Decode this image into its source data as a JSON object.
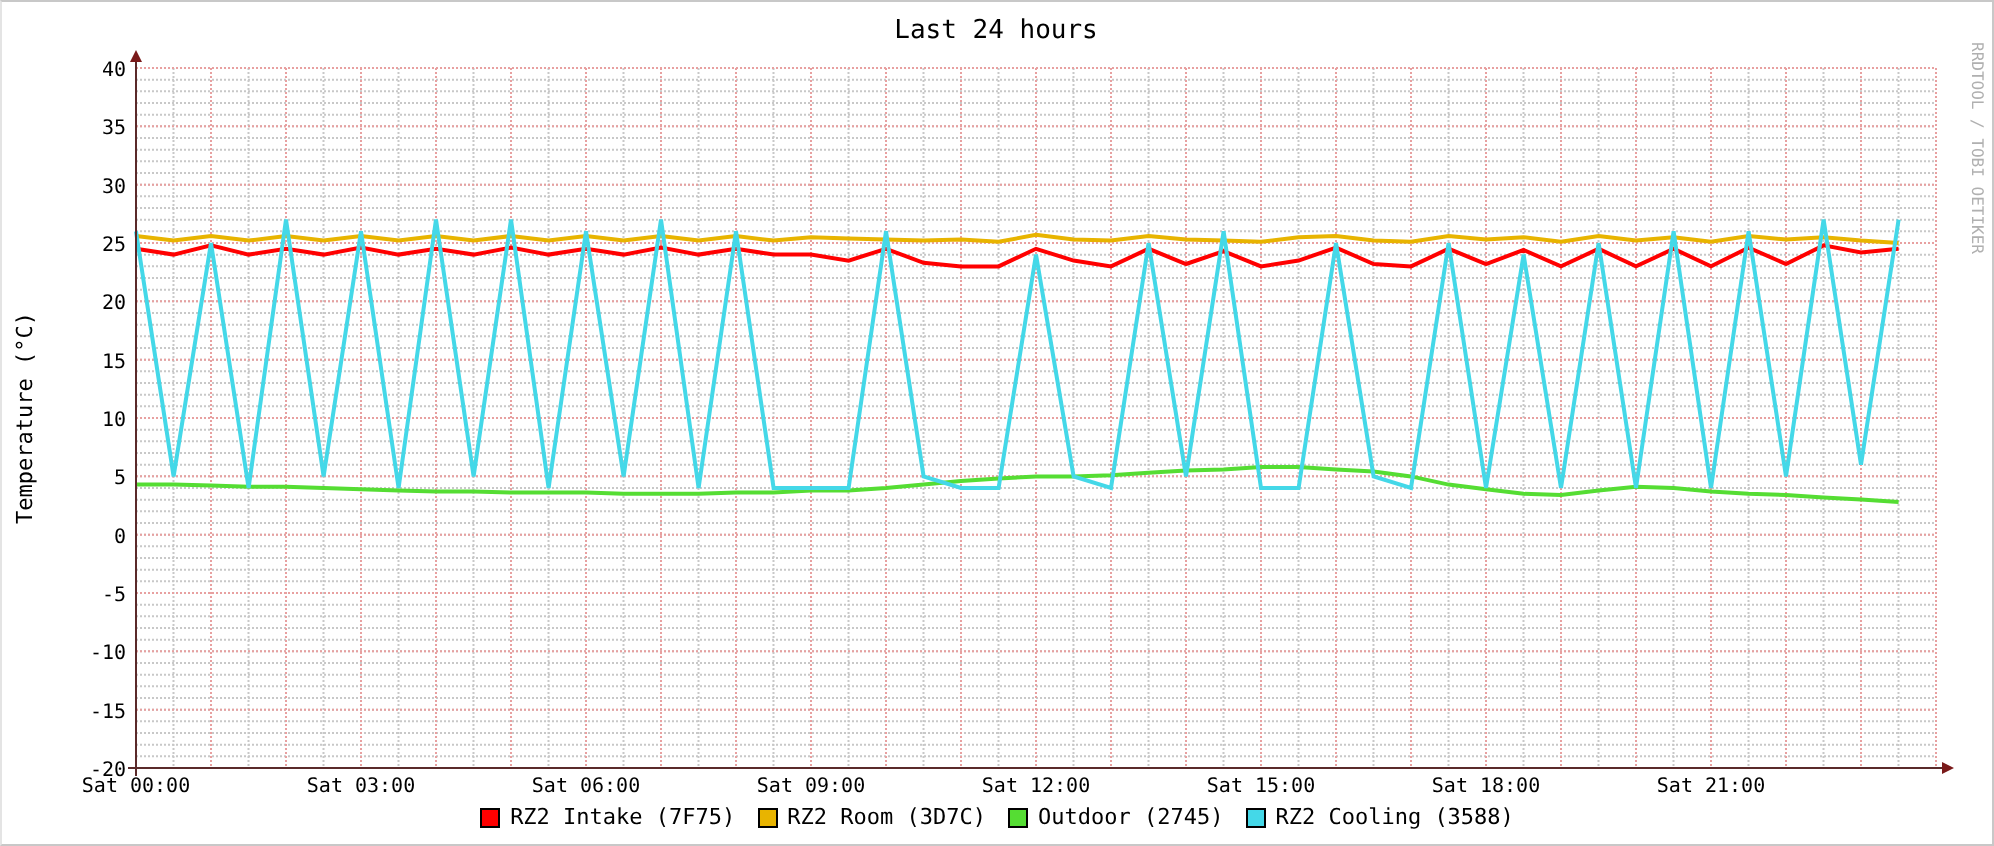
{
  "graph": {
    "credit": "RRDTOOL / TOBI OETIKER",
    "chart_data": {
      "type": "line",
      "title": "Last 24 hours",
      "ylabel": "Temperature (°C)",
      "categories": [
        "Sat 00:00",
        null,
        null,
        null,
        null,
        null,
        "Sat 03:00",
        null,
        null,
        null,
        null,
        null,
        "Sat 06:00",
        null,
        null,
        null,
        null,
        null,
        "Sat 09:00",
        null,
        null,
        null,
        null,
        null,
        "Sat 12:00",
        null,
        null,
        null,
        null,
        null,
        "Sat 15:00",
        null,
        null,
        null,
        null,
        null,
        "Sat 18:00",
        null,
        null,
        null,
        null,
        null,
        "Sat 21:00",
        null,
        null,
        null,
        null,
        null
      ],
      "ylim": [
        -20,
        40
      ],
      "grid": true,
      "yticks": [
        -20,
        -15,
        -10,
        -5,
        0,
        5,
        10,
        15,
        20,
        25,
        30,
        35,
        40
      ],
      "series": [
        {
          "name": "RZ2 Intake (7F75)",
          "color": "#ff0000",
          "values": [
            24.5,
            24,
            24.8,
            24,
            24.5,
            24,
            24.6,
            24,
            24.5,
            24,
            24.6,
            24,
            24.5,
            24,
            24.6,
            24,
            24.5,
            24,
            24,
            23.5,
            24.5,
            23.3,
            23,
            23,
            24.5,
            23.5,
            23,
            24.5,
            23.2,
            24.3,
            23,
            23.5,
            24.6,
            23.2,
            23,
            24.5,
            23.2,
            24.4,
            23,
            24.5,
            23,
            24.5,
            23,
            24.6,
            23.2,
            24.8,
            24.2,
            24.5
          ]
        },
        {
          "name": "RZ2 Room (3D7C)",
          "color": "#e8b400",
          "values": [
            25.6,
            25.2,
            25.6,
            25.2,
            25.6,
            25.2,
            25.6,
            25.2,
            25.6,
            25.2,
            25.6,
            25.2,
            25.6,
            25.2,
            25.6,
            25.2,
            25.6,
            25.2,
            25.5,
            25.4,
            25.3,
            25.2,
            25.3,
            25.1,
            25.7,
            25.3,
            25.2,
            25.6,
            25.3,
            25.2,
            25.1,
            25.5,
            25.6,
            25.2,
            25.1,
            25.6,
            25.3,
            25.5,
            25.1,
            25.6,
            25.2,
            25.5,
            25.1,
            25.6,
            25.3,
            25.5,
            25.2,
            25.0
          ]
        },
        {
          "name": "Outdoor (2745)",
          "color": "#55dd33",
          "values": [
            4.3,
            4.3,
            4.2,
            4.1,
            4.1,
            4.0,
            3.9,
            3.8,
            3.7,
            3.7,
            3.6,
            3.6,
            3.6,
            3.5,
            3.5,
            3.5,
            3.6,
            3.6,
            3.8,
            3.8,
            4.0,
            4.3,
            4.6,
            4.8,
            5.0,
            5.0,
            5.1,
            5.3,
            5.5,
            5.6,
            5.8,
            5.8,
            5.6,
            5.4,
            5.0,
            4.3,
            3.9,
            3.5,
            3.4,
            3.8,
            4.1,
            4.0,
            3.7,
            3.5,
            3.4,
            3.2,
            3.0,
            2.8
          ]
        },
        {
          "name": "RZ2 Cooling (3588)",
          "color": "#44d8e8",
          "values": [
            26,
            5,
            25,
            4,
            27,
            5,
            26,
            4,
            27,
            5,
            27,
            4,
            26,
            5,
            27,
            4,
            26,
            4,
            4,
            4,
            26,
            5,
            4,
            4,
            24,
            5,
            4,
            25,
            5,
            26,
            4,
            4,
            25,
            5,
            4,
            25,
            4,
            24,
            4,
            25,
            4,
            26,
            4,
            26,
            5,
            27,
            6,
            27
          ]
        }
      ]
    }
  }
}
